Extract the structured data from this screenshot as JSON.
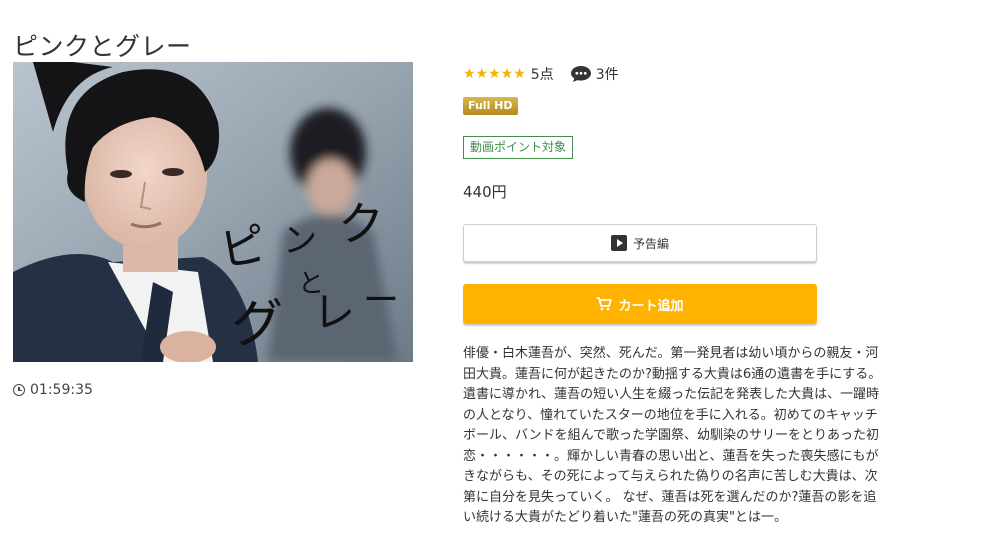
{
  "title": "ピンクとグレー",
  "poster": {
    "title_chars": [
      "ピ",
      "ン",
      "ク",
      "と",
      "グ",
      "レ",
      "ー"
    ]
  },
  "duration": "01:59:35",
  "rating": {
    "stars": "★★★★★",
    "score_label": "5点",
    "review_count": "3件"
  },
  "badges": {
    "fullhd": "Full HD",
    "points": "動画ポイント対象"
  },
  "price": "440円",
  "buttons": {
    "trailer": "予告編",
    "cart": "カート追加"
  },
  "description": "俳優・白木蓮吾が、突然、死んだ。第一発見者は幼い頃からの親友・河\n田大貴。蓮吾に何が起きたのか?動揺する大貴は6通の遺書を手にする。\n遺書に導かれ、蓮吾の短い人生を綴った伝記を発表した大貴は、一躍時\nの人となり、憧れていたスターの地位を手に入れる。初めてのキャッチ\nボール、バンドを組んで歌った学園祭、幼馴染のサリーをとりあった初\n恋・・・・・・。輝かしい青春の思い出と、蓮吾を失った喪失感にもが\nきながらも、その死によって与えられた偽りの名声に苦しむ大貴は、次\n第に自分を見失っていく。 なぜ、蓮吾は死を選んだのか?蓮吾の影を追\nい続ける大貴がたどり着いた\"蓮吾の死の真実\"とは一。",
  "colors": {
    "star": "#f4b400",
    "cart_button": "#ffb300",
    "points_border": "#3f8f4a",
    "fullhd_badge": "#c9a030"
  }
}
